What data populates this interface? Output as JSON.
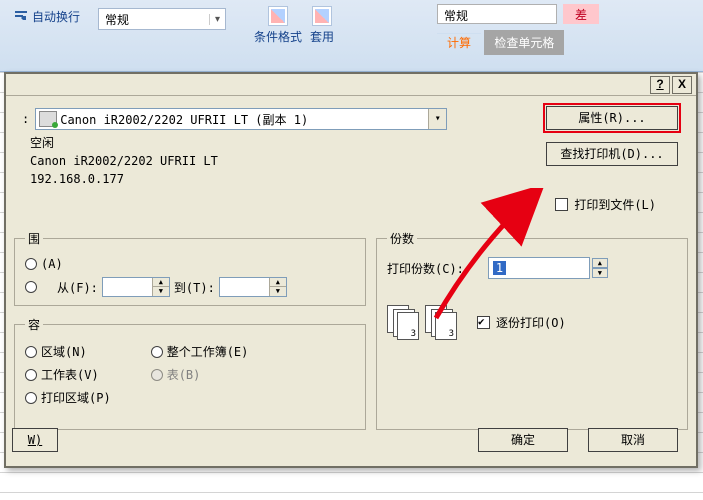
{
  "ribbon": {
    "autowrap": "自动换行",
    "numberFormat": "常规",
    "condFormat": "条件格式",
    "tableStyle": "套用",
    "styleBox": "常规",
    "diff": "差",
    "checkCells": "检查单元格",
    "calc": "计算"
  },
  "dialog": {
    "helpBtn": "?",
    "closeBtn": "X",
    "printer": {
      "label": ":",
      "name": "Canon iR2002/2202 UFRII LT (副本 1)",
      "status": "空闲",
      "model": "Canon iR2002/2202 UFRII LT",
      "ip": "192.168.0.177"
    },
    "propertiesBtn": "属性(R)...",
    "findPrinterBtn": "查找打印机(D)...",
    "printToFile": "打印到文件(L)",
    "range": {
      "legend": "围",
      "allLabel": "(A)",
      "fromLabel": "从(F):",
      "toLabel": "到(T):",
      "fromValue": "",
      "toValue": ""
    },
    "content": {
      "legend": "容",
      "areaLabel": "区域(N)",
      "wholeWorkbook": "整个工作簿(E)",
      "worksheets": "工作表(V)",
      "table": "表(B)",
      "printAreas": "打印区域(P)"
    },
    "copies": {
      "legend": "份数",
      "countLabel": "打印份数(C):",
      "countValue": "1",
      "collate": "逐份打印(O)"
    },
    "preview": "W)",
    "ok": "确定",
    "cancel": "取消"
  }
}
